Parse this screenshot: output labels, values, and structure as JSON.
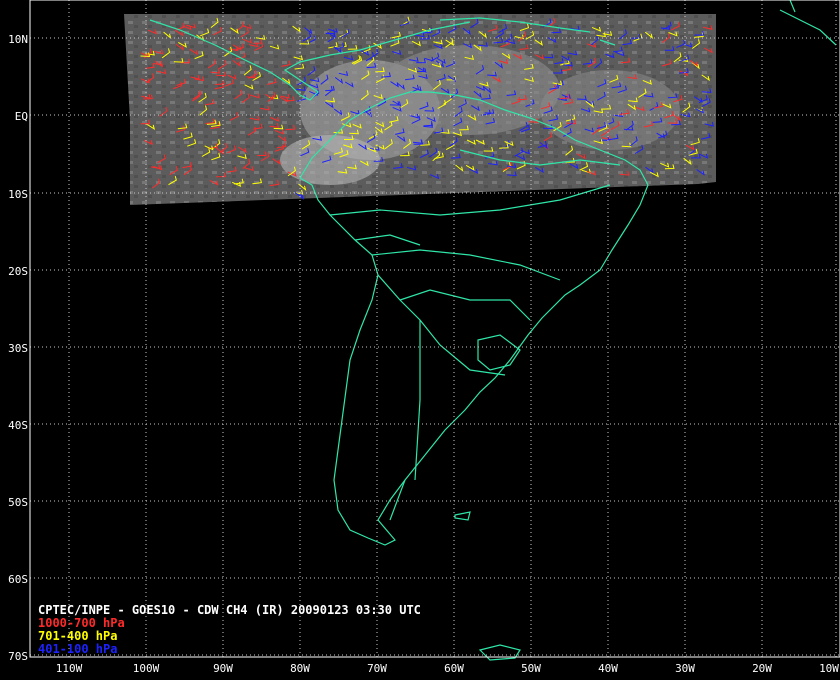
{
  "title": "CPTEC/INPE - GOES10 - CDW CH4 (IR) 20090123 03:30 UTC",
  "legend": [
    {
      "label": "1000-700 hPa",
      "color": "#ff2a2a"
    },
    {
      "label": "701-400 hPa",
      "color": "#ffff00"
    },
    {
      "label": "401-100 hPa",
      "color": "#1d22ff"
    }
  ],
  "colors": {
    "coast": "#2fe6a8",
    "grid": "#c8c8c8",
    "satellite": "#6a6a6a"
  },
  "axes": {
    "lat_labels": [
      "10N",
      "EQ",
      "10S",
      "20S",
      "30S",
      "40S",
      "50S",
      "60S",
      "70S"
    ],
    "lon_labels": [
      "110W",
      "100W",
      "90W",
      "80W",
      "70W",
      "60W",
      "50W",
      "40W",
      "30W",
      "20W",
      "10W"
    ]
  }
}
